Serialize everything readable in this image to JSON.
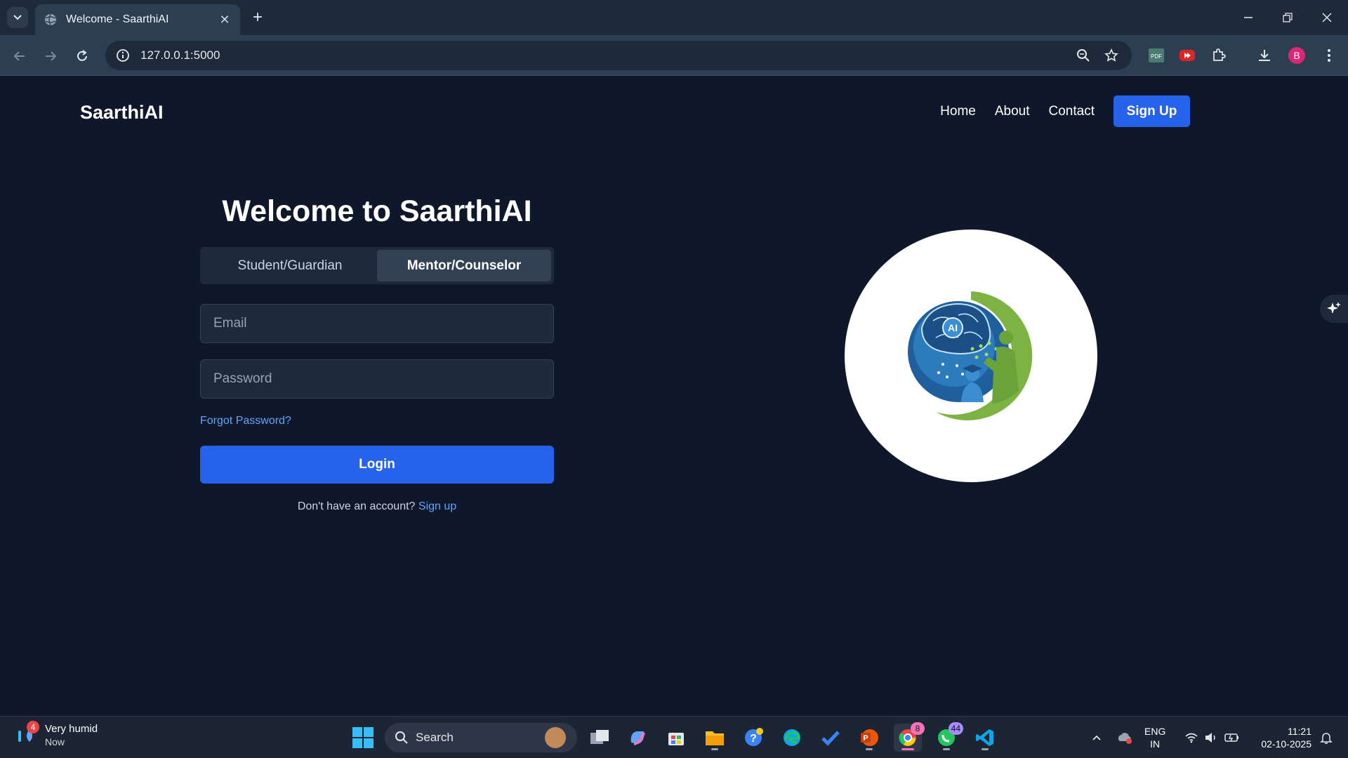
{
  "browser": {
    "tab_title": "Welcome - SaarthiAI",
    "url": "127.0.0.1:5000",
    "profile_initial": "B"
  },
  "site": {
    "brand": "SaarthiAI",
    "nav": [
      "Home",
      "About",
      "Contact"
    ],
    "signup_button": "Sign Up"
  },
  "login": {
    "heading": "Welcome to SaarthiAI",
    "roles": [
      "Student/Guardian",
      "Mentor/Counselor"
    ],
    "active_role": "Mentor/Counselor",
    "email_placeholder": "Email",
    "password_placeholder": "Password",
    "forgot_link": "Forgot Password?",
    "login_button": "Login",
    "no_account_text": "Don't have an account?",
    "signup_link": "Sign up"
  },
  "logo": {
    "badge_text": "AI",
    "colors": {
      "blue": "#1f5f9e",
      "green": "#7cb342"
    }
  },
  "taskbar": {
    "weather_title": "Very humid",
    "weather_sub": "Now",
    "weather_badge": "4",
    "search_label": "Search",
    "chrome_badge": "8",
    "whatsapp_badge": "44",
    "lang_line1": "ENG",
    "lang_line2": "IN",
    "time": "11:21",
    "date": "02-10-2025"
  },
  "colors": {
    "page_bg": "#0f172a",
    "accent": "#2563eb",
    "link": "#60a5fa"
  }
}
